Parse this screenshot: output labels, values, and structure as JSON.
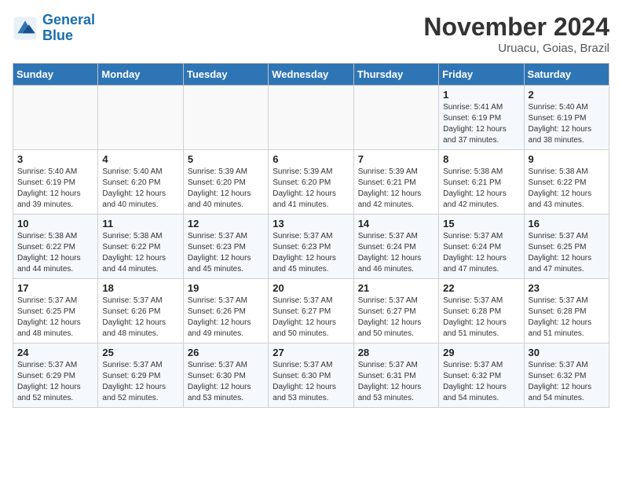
{
  "logo": {
    "line1": "General",
    "line2": "Blue"
  },
  "title": "November 2024",
  "subtitle": "Uruacu, Goias, Brazil",
  "days_of_week": [
    "Sunday",
    "Monday",
    "Tuesday",
    "Wednesday",
    "Thursday",
    "Friday",
    "Saturday"
  ],
  "weeks": [
    [
      {
        "day": "",
        "info": ""
      },
      {
        "day": "",
        "info": ""
      },
      {
        "day": "",
        "info": ""
      },
      {
        "day": "",
        "info": ""
      },
      {
        "day": "",
        "info": ""
      },
      {
        "day": "1",
        "info": "Sunrise: 5:41 AM\nSunset: 6:19 PM\nDaylight: 12 hours and 37 minutes."
      },
      {
        "day": "2",
        "info": "Sunrise: 5:40 AM\nSunset: 6:19 PM\nDaylight: 12 hours and 38 minutes."
      }
    ],
    [
      {
        "day": "3",
        "info": "Sunrise: 5:40 AM\nSunset: 6:19 PM\nDaylight: 12 hours and 39 minutes."
      },
      {
        "day": "4",
        "info": "Sunrise: 5:40 AM\nSunset: 6:20 PM\nDaylight: 12 hours and 40 minutes."
      },
      {
        "day": "5",
        "info": "Sunrise: 5:39 AM\nSunset: 6:20 PM\nDaylight: 12 hours and 40 minutes."
      },
      {
        "day": "6",
        "info": "Sunrise: 5:39 AM\nSunset: 6:20 PM\nDaylight: 12 hours and 41 minutes."
      },
      {
        "day": "7",
        "info": "Sunrise: 5:39 AM\nSunset: 6:21 PM\nDaylight: 12 hours and 42 minutes."
      },
      {
        "day": "8",
        "info": "Sunrise: 5:38 AM\nSunset: 6:21 PM\nDaylight: 12 hours and 42 minutes."
      },
      {
        "day": "9",
        "info": "Sunrise: 5:38 AM\nSunset: 6:22 PM\nDaylight: 12 hours and 43 minutes."
      }
    ],
    [
      {
        "day": "10",
        "info": "Sunrise: 5:38 AM\nSunset: 6:22 PM\nDaylight: 12 hours and 44 minutes."
      },
      {
        "day": "11",
        "info": "Sunrise: 5:38 AM\nSunset: 6:22 PM\nDaylight: 12 hours and 44 minutes."
      },
      {
        "day": "12",
        "info": "Sunrise: 5:37 AM\nSunset: 6:23 PM\nDaylight: 12 hours and 45 minutes."
      },
      {
        "day": "13",
        "info": "Sunrise: 5:37 AM\nSunset: 6:23 PM\nDaylight: 12 hours and 45 minutes."
      },
      {
        "day": "14",
        "info": "Sunrise: 5:37 AM\nSunset: 6:24 PM\nDaylight: 12 hours and 46 minutes."
      },
      {
        "day": "15",
        "info": "Sunrise: 5:37 AM\nSunset: 6:24 PM\nDaylight: 12 hours and 47 minutes."
      },
      {
        "day": "16",
        "info": "Sunrise: 5:37 AM\nSunset: 6:25 PM\nDaylight: 12 hours and 47 minutes."
      }
    ],
    [
      {
        "day": "17",
        "info": "Sunrise: 5:37 AM\nSunset: 6:25 PM\nDaylight: 12 hours and 48 minutes."
      },
      {
        "day": "18",
        "info": "Sunrise: 5:37 AM\nSunset: 6:26 PM\nDaylight: 12 hours and 48 minutes."
      },
      {
        "day": "19",
        "info": "Sunrise: 5:37 AM\nSunset: 6:26 PM\nDaylight: 12 hours and 49 minutes."
      },
      {
        "day": "20",
        "info": "Sunrise: 5:37 AM\nSunset: 6:27 PM\nDaylight: 12 hours and 50 minutes."
      },
      {
        "day": "21",
        "info": "Sunrise: 5:37 AM\nSunset: 6:27 PM\nDaylight: 12 hours and 50 minutes."
      },
      {
        "day": "22",
        "info": "Sunrise: 5:37 AM\nSunset: 6:28 PM\nDaylight: 12 hours and 51 minutes."
      },
      {
        "day": "23",
        "info": "Sunrise: 5:37 AM\nSunset: 6:28 PM\nDaylight: 12 hours and 51 minutes."
      }
    ],
    [
      {
        "day": "24",
        "info": "Sunrise: 5:37 AM\nSunset: 6:29 PM\nDaylight: 12 hours and 52 minutes."
      },
      {
        "day": "25",
        "info": "Sunrise: 5:37 AM\nSunset: 6:29 PM\nDaylight: 12 hours and 52 minutes."
      },
      {
        "day": "26",
        "info": "Sunrise: 5:37 AM\nSunset: 6:30 PM\nDaylight: 12 hours and 53 minutes."
      },
      {
        "day": "27",
        "info": "Sunrise: 5:37 AM\nSunset: 6:30 PM\nDaylight: 12 hours and 53 minutes."
      },
      {
        "day": "28",
        "info": "Sunrise: 5:37 AM\nSunset: 6:31 PM\nDaylight: 12 hours and 53 minutes."
      },
      {
        "day": "29",
        "info": "Sunrise: 5:37 AM\nSunset: 6:32 PM\nDaylight: 12 hours and 54 minutes."
      },
      {
        "day": "30",
        "info": "Sunrise: 5:37 AM\nSunset: 6:32 PM\nDaylight: 12 hours and 54 minutes."
      }
    ]
  ]
}
